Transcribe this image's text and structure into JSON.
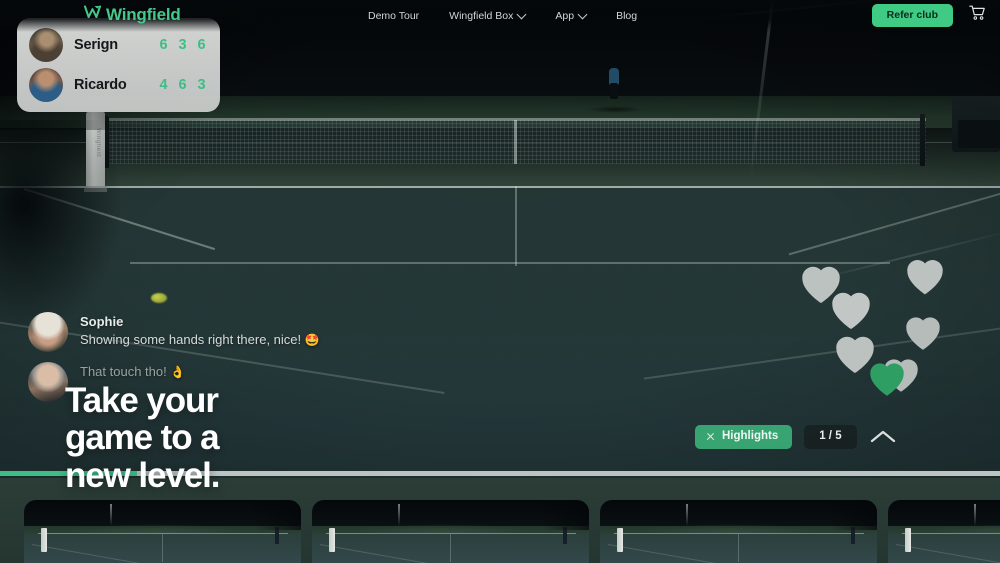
{
  "brand": {
    "name": "Wingfield",
    "logo_icon": "wingfield-w-mark",
    "color": "#45c98a"
  },
  "nav": {
    "items": [
      {
        "label": "Demo Tour",
        "has_dropdown": false
      },
      {
        "label": "Wingfield Box",
        "has_dropdown": true,
        "icon": "chevron-down-icon"
      },
      {
        "label": "App",
        "has_dropdown": true,
        "icon": "chevron-down-icon"
      },
      {
        "label": "Blog",
        "has_dropdown": false
      }
    ],
    "refer_button": "Refer club",
    "cart_icon": "shopping-cart-icon"
  },
  "scoreboard": {
    "players": [
      {
        "name": "Serign",
        "avatar": "player-avatar-serign",
        "sets": [
          "6",
          "3",
          "6"
        ]
      },
      {
        "name": "Ricardo",
        "avatar": "player-avatar-ricardo",
        "sets": [
          "4",
          "6",
          "3"
        ]
      }
    ],
    "score_color": "#3fbd86"
  },
  "chat": {
    "messages": [
      {
        "author": "Sophie",
        "text": "Showing some hands right there, nice!",
        "emoji": "🤩",
        "avatar": "chat-avatar-sophie"
      },
      {
        "author": "",
        "text": "That touch tho!",
        "emoji": "👌",
        "avatar": "chat-avatar-second-user"
      }
    ]
  },
  "reactions": {
    "icon": "heart-icon",
    "total": 6,
    "active": 1,
    "active_color": "#2e9e63",
    "inactive_color": "#b9bfbd"
  },
  "controls": {
    "highlights_label": "Highlights",
    "close_icon": "close-x-icon",
    "counter": "1 / 5",
    "collapse_icon": "chevron-up-icon"
  },
  "headline": {
    "line1": "Take your",
    "line2": "game to a",
    "line3": "new level."
  },
  "progress": {
    "percent": 13.7,
    "fill_color": "#3fbd86",
    "track_color": "#bcc4c2"
  },
  "thumbnails": [
    {
      "name": "court-clip-1"
    },
    {
      "name": "court-clip-2"
    },
    {
      "name": "court-clip-3"
    },
    {
      "name": "court-clip-4"
    }
  ],
  "scene": {
    "description": "tennis-court-night-video",
    "ball_icon": "tennis-ball",
    "player_icon": "tennis-player"
  }
}
